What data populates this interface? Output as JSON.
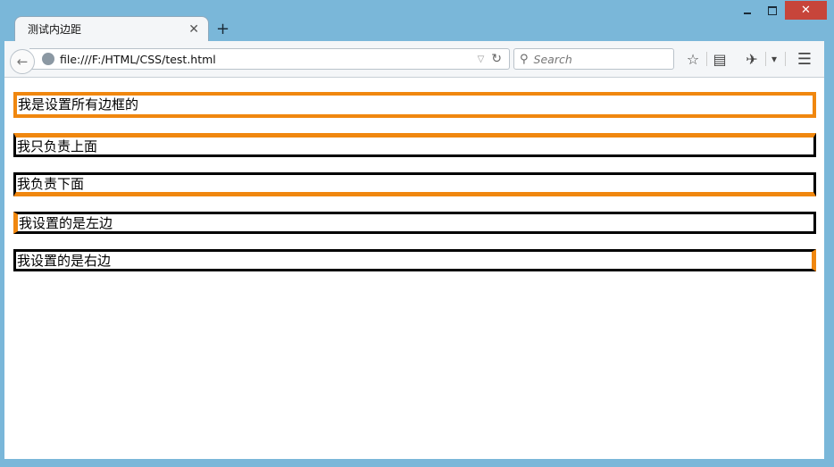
{
  "window": {
    "minimize_icon": "minimize-icon",
    "maximize_icon": "maximize-icon",
    "close_glyph": "✕"
  },
  "tab": {
    "title": "测试内边距",
    "close_glyph": "✕",
    "new_tab_glyph": "+"
  },
  "navbar": {
    "back_glyph": "←",
    "url": "file:///F:/HTML/CSS/test.html",
    "url_dropdown_glyph": "▽",
    "reload_glyph": "↻",
    "search_placeholder": "Search",
    "bookmark_star_glyph": "☆",
    "reader_glyph": "▤",
    "addon_glyph": "✈",
    "dropdown_glyph": "▾",
    "menu_glyph": "☰"
  },
  "content": {
    "boxes": [
      {
        "text": "我是设置所有边框的"
      },
      {
        "text": "我只负责上面"
      },
      {
        "text": "我负责下面"
      },
      {
        "text": "我设置的是左边"
      },
      {
        "text": "我设置的是右边"
      }
    ]
  },
  "colors": {
    "accent_border": "#f0870f",
    "plain_border": "#000000",
    "window_frame": "#7ab7d9",
    "close_button": "#c7453a"
  }
}
